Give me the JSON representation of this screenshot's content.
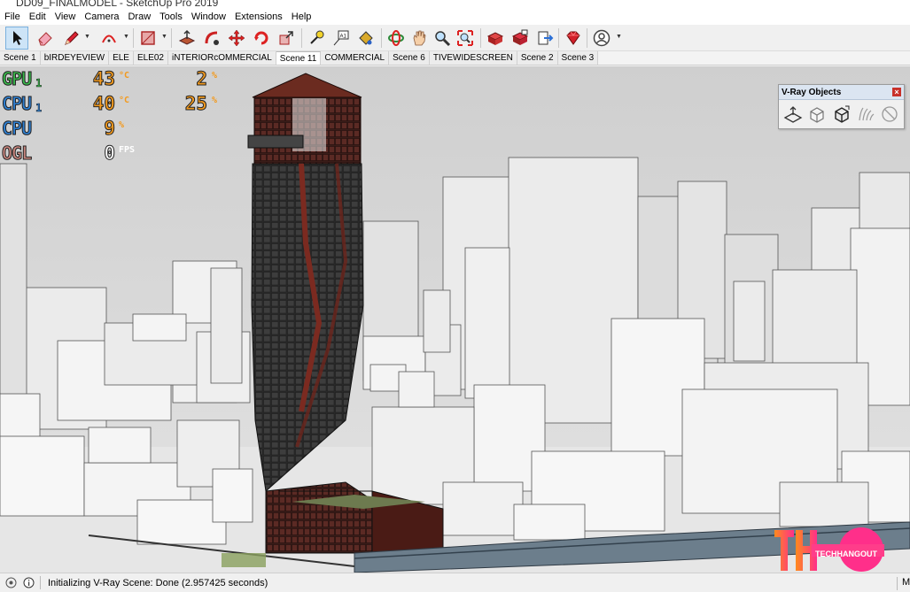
{
  "window": {
    "title": "DD09_FINALMODEL - SketchUp Pro 2019"
  },
  "menu": [
    "File",
    "Edit",
    "View",
    "Camera",
    "Draw",
    "Tools",
    "Window",
    "Extensions",
    "Help"
  ],
  "toolbar": {
    "tools": [
      "select-arrow-icon",
      "eraser-icon",
      "pencil-line-icon",
      "arc-icon",
      "rectangle-shape-icon",
      "push-pull-icon",
      "follow-me-icon",
      "move-icon",
      "rotate-icon",
      "scale-icon",
      "tape-measure-icon",
      "text-label-icon",
      "paint-bucket-icon",
      "orbit-icon",
      "pan-icon",
      "zoom-icon",
      "zoom-extents-icon",
      "3d-warehouse-icon",
      "extension-warehouse-icon",
      "send-to-layout-icon",
      "ruby-console-icon",
      "account-icon"
    ]
  },
  "scenes": {
    "tabs": [
      "Scene 1",
      "bIRDEYEVIEW",
      "ELE",
      "ELE02",
      "iNTERIORcOMMERCIAL",
      "Scene 11",
      "COMMERCIAL",
      "Scene 6",
      "TIVEWIDESCREEN",
      "Scene 2",
      "Scene 3"
    ],
    "active": "Scene 11"
  },
  "overlay": {
    "gpu1": {
      "label": "GPU",
      "sub": "1",
      "temp": "43",
      "temp_unit": "°C",
      "load": "2",
      "load_unit": "%"
    },
    "cpu1": {
      "label": "CPU",
      "sub": "1",
      "temp": "40",
      "temp_unit": "°C",
      "load": "25",
      "load_unit": "%"
    },
    "cpu": {
      "label": "CPU",
      "load": "9",
      "load_unit": "%"
    },
    "ogl": {
      "label": "OGL",
      "fps": "0",
      "fps_unit": "FPS"
    },
    "colors": {
      "gpu": "#39b54a",
      "cpu": "#2f7fd1",
      "ogl": "#c8857d",
      "value": "#f39a1e",
      "white": "#ffffff"
    }
  },
  "vray_panel": {
    "title": "V-Ray Objects",
    "icons": [
      "vray-light-plane-icon",
      "vray-proxy-icon",
      "vray-mesh-export-icon",
      "vray-fur-icon",
      "vray-clipper-icon"
    ]
  },
  "watermark": {
    "text": "TECHHANGOUT",
    "colors": [
      "#ff2f8a",
      "#ff8a1e"
    ]
  },
  "status": {
    "text": "Initializing V-Ray Scene: Done (2.957425 seconds)",
    "right": "M"
  }
}
